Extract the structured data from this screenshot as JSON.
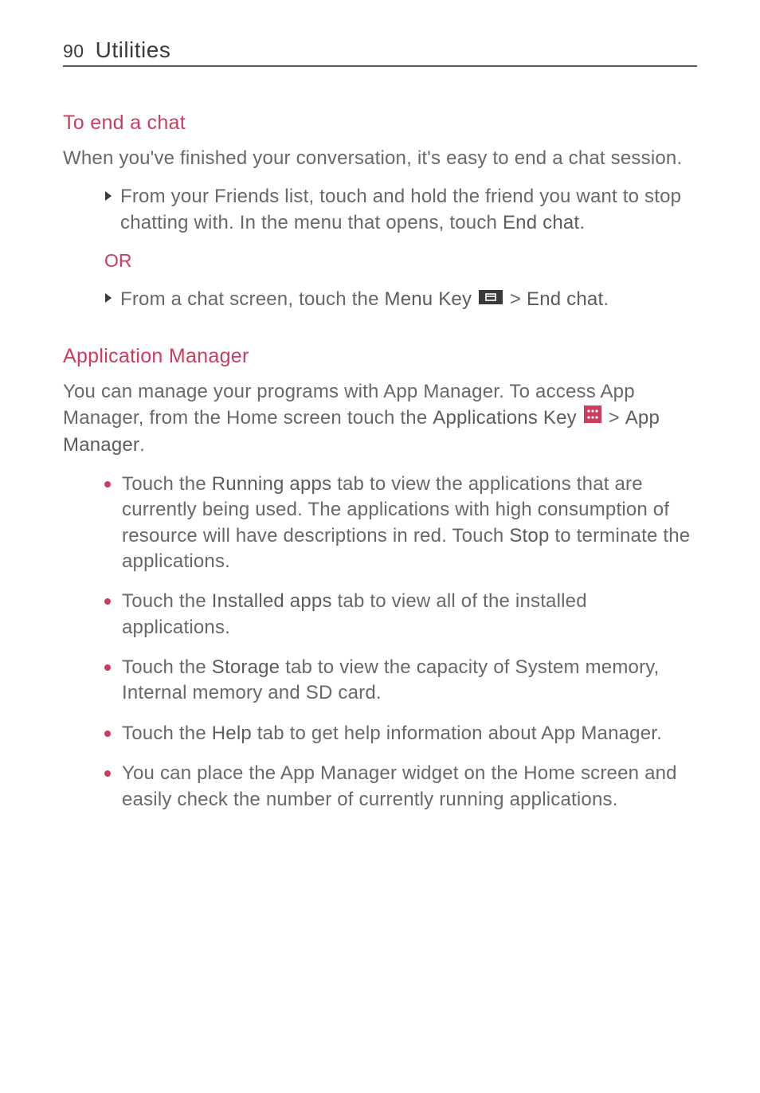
{
  "header": {
    "page_number": "90",
    "section": "Utilities"
  },
  "s1": {
    "heading": "To end a chat",
    "intro": "When you've finished your conversation, it's easy to end a chat session.",
    "item1_a": "From your Friends list, touch and hold the friend you want to stop chatting with. In the menu that opens, touch ",
    "item1_b": "End chat",
    "item1_c": ".",
    "or": "OR",
    "item2_a": "From a chat screen, touch the ",
    "item2_b": "Menu Key",
    "item2_c": " > ",
    "item2_d": "End chat",
    "item2_e": "."
  },
  "s2": {
    "heading": "Application Manager",
    "intro_a": "You can manage your programs with App Manager. To access App Manager, from the Home screen touch the ",
    "intro_b": "Applications Key",
    "intro_c": " > ",
    "intro_d": "App Manager",
    "intro_e": ".",
    "b1_a": "Touch the ",
    "b1_b": "Running apps",
    "b1_c": " tab to view the applications that are currently being used. The applications with high consumption of resource will have descriptions in red. Touch ",
    "b1_d": "Stop",
    "b1_e": " to terminate the applications.",
    "b2_a": "Touch the ",
    "b2_b": "Installed apps",
    "b2_c": " tab to view all of the installed applications.",
    "b3_a": "Touch the ",
    "b3_b": "Storage",
    "b3_c": " tab to view the capacity of System memory, Internal memory and SD card.",
    "b4_a": "Touch the ",
    "b4_b": "Help",
    "b4_c": " tab to get help information about App Manager.",
    "b5": "You can place the App Manager widget on the Home screen and easily check the number of currently running applications."
  }
}
